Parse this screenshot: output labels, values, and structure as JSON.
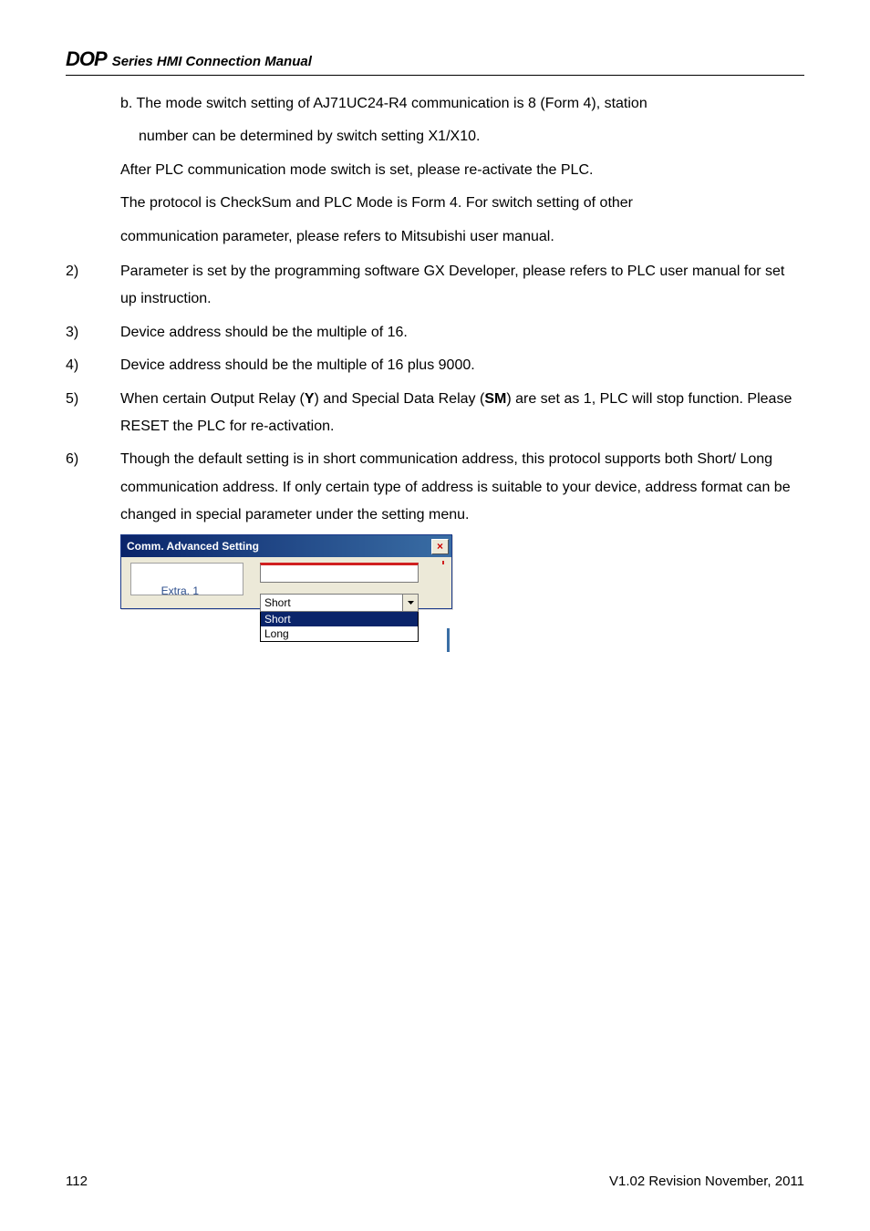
{
  "header": {
    "logo": "DOP",
    "title": "Series HMI Connection Manual"
  },
  "item_b": {
    "line1": "b. The mode switch setting of AJ71UC24-R4 communication is 8 (Form 4), station",
    "line2": "number can be determined by switch setting X1/X10."
  },
  "after_b": {
    "l1": "After PLC communication mode switch is set, please re-activate the PLC.",
    "l2": "The protocol is CheckSum and PLC Mode is Form 4. For switch setting of other",
    "l3": "communication parameter, please refers to Mitsubishi user manual."
  },
  "items": [
    {
      "num": "2)",
      "text": "Parameter is set by the programming software GX Developer, please refers to PLC user manual for set up instruction."
    },
    {
      "num": "3)",
      "text": "Device address should be the multiple of 16."
    },
    {
      "num": "4)",
      "text": "Device address should be the multiple of 16 plus 9000."
    },
    {
      "num": "5)",
      "pre": "When certain Output Relay (",
      "b1": "Y",
      "mid": ") and Special Data Relay (",
      "b2": "SM",
      "post": ") are set as 1, PLC will stop function. Please RESET the PLC for re-activation."
    },
    {
      "num": "6)",
      "text": "Though the default setting is in short communication address, this protocol supports both Short/ Long communication address. If only certain type of address is suitable to your device, address format can be changed in special parameter under the setting menu."
    }
  ],
  "dialog": {
    "title": "Comm. Advanced Setting",
    "close": "×",
    "label": "Extra. 1",
    "value": "Short",
    "options": [
      "Short",
      "Long"
    ]
  },
  "footer": {
    "page": "112",
    "rev": "V1.02  Revision November, 2011"
  }
}
